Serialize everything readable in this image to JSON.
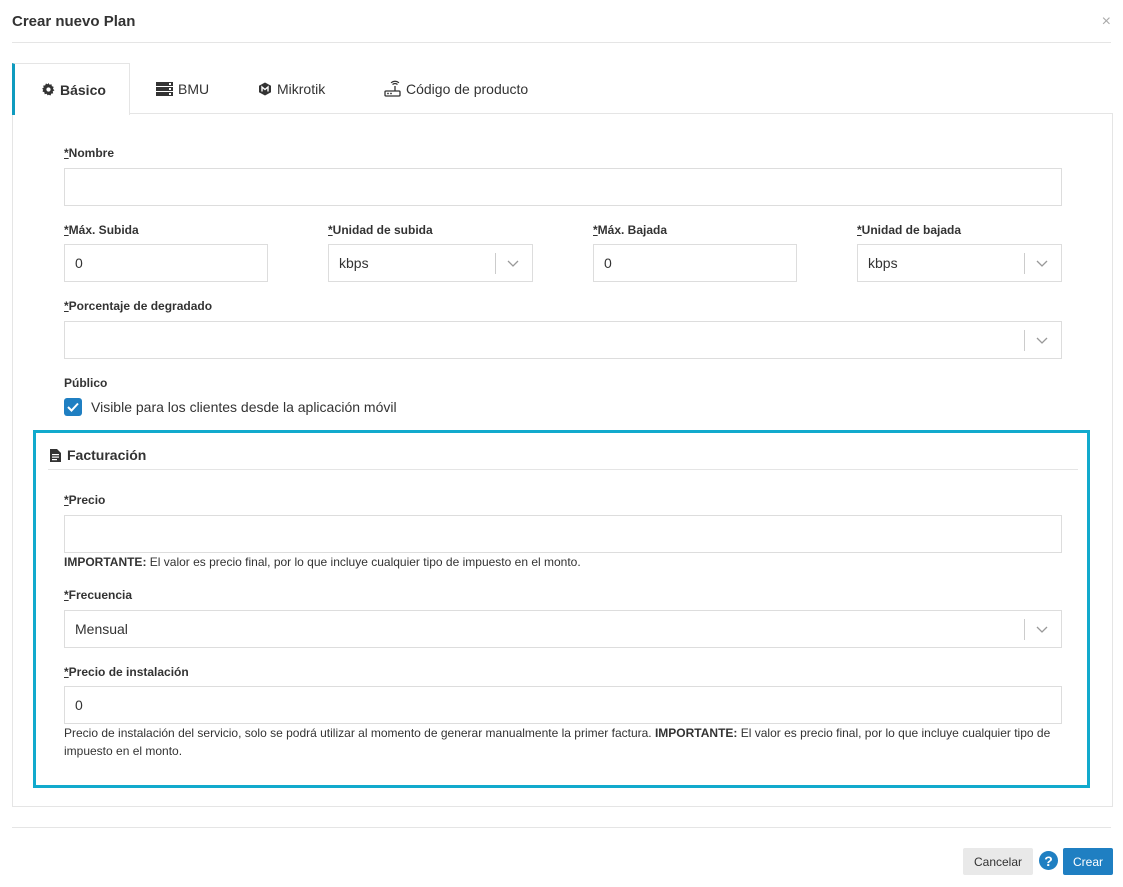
{
  "modal": {
    "title": "Crear nuevo Plan",
    "close": "×"
  },
  "tabs": [
    {
      "label": "Básico",
      "icon": "gear-icon"
    },
    {
      "label": "BMU",
      "icon": "server-icon"
    },
    {
      "label": "Mikrotik",
      "icon": "mikrotik-icon"
    },
    {
      "label": "Código de producto",
      "icon": "router-icon"
    }
  ],
  "form": {
    "req_mark": "*",
    "nombre": {
      "label": "Nombre",
      "value": ""
    },
    "max_subida": {
      "label": "Máx. Subida",
      "value": "0"
    },
    "unidad_subida": {
      "label": "Unidad de subida",
      "value": "kbps"
    },
    "max_bajada": {
      "label": "Máx. Bajada",
      "value": "0"
    },
    "unidad_bajada": {
      "label": "Unidad de bajada",
      "value": "kbps"
    },
    "degradado": {
      "label": "Porcentaje de degradado",
      "value": ""
    },
    "publico": {
      "label": "Público",
      "checkbox_label": "Visible para los clientes desde la aplicación móvil",
      "checked": true
    }
  },
  "facturacion": {
    "title": "Facturación",
    "precio": {
      "label": "Precio",
      "value": "",
      "help_strong": "IMPORTANTE:",
      "help_text": " El valor es precio final, por lo que incluye cualquier tipo de impuesto en el monto."
    },
    "frecuencia": {
      "label": "Frecuencia",
      "value": "Mensual"
    },
    "instalacion": {
      "label": "Precio de instalación",
      "value": "0",
      "help_text_1": "Precio de instalación del servicio, solo se podrá utilizar al momento de generar manualmente la primer factura. ",
      "help_strong": "IMPORTANTE:",
      "help_text_2": " El valor es precio final, por lo que incluye cualquier tipo de impuesto en el monto."
    }
  },
  "footer": {
    "cancel": "Cancelar",
    "help": "?",
    "create": "Crear"
  },
  "colors": {
    "accent": "#1f7fc2",
    "highlight_border": "#11aacd",
    "active_tab_border": "#0f9bbf"
  }
}
